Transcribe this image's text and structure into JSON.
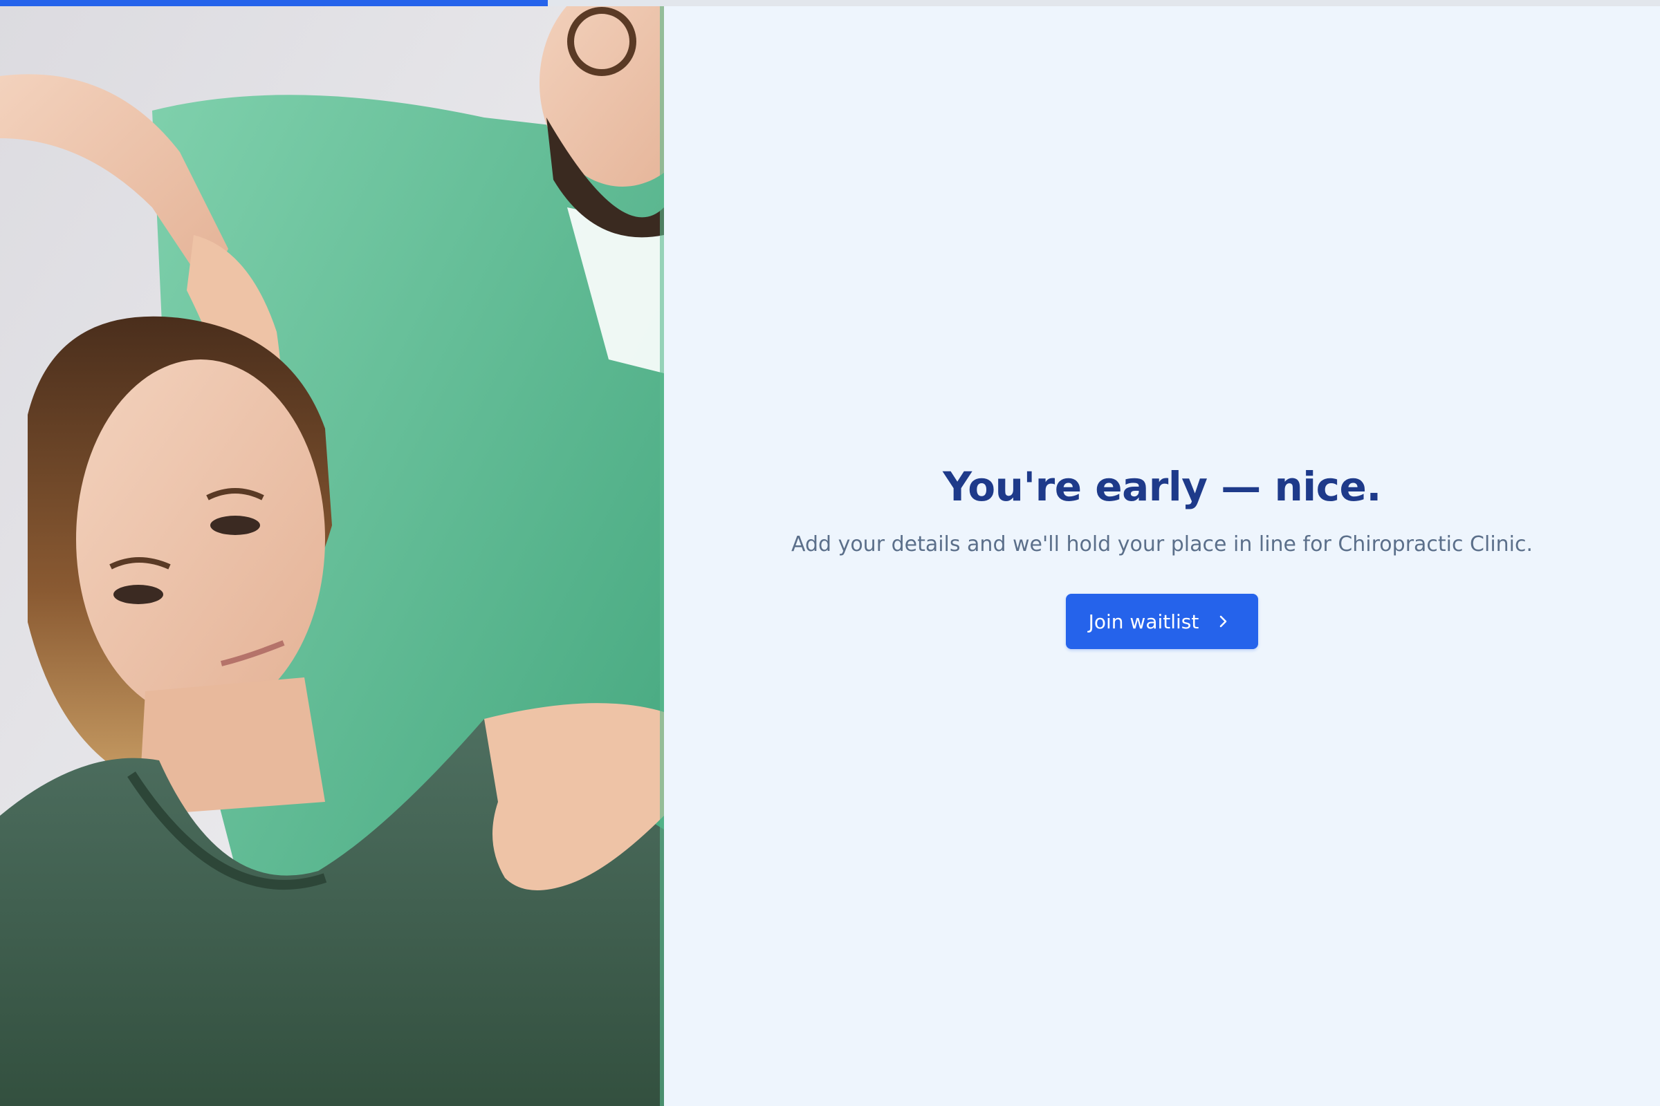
{
  "progress": {
    "fraction": 0.33,
    "color": "#2563eb"
  },
  "photo": {
    "description_icon": "chiropractor-photo"
  },
  "main": {
    "headline": "You're early — nice.",
    "subtext": "Add your details and we'll hold your place in line for Chiropractic Clinic.",
    "cta_label": "Join waitlist",
    "cta_icon": "chevron-right-icon"
  },
  "colors": {
    "accent": "#2563eb",
    "headline": "#1e3a8a",
    "subtext": "#5b6f8a",
    "background": "#eef5fd"
  }
}
